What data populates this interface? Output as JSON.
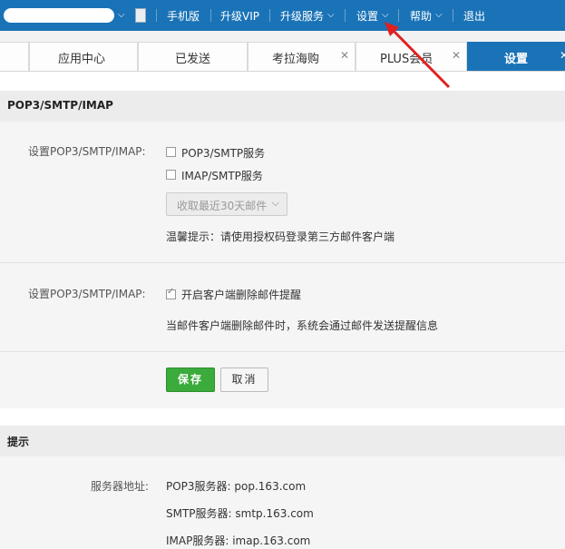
{
  "topbar": {
    "nav": [
      "手机版",
      "升级VIP",
      "升级服务",
      "设置",
      "帮助",
      "退出"
    ]
  },
  "tabs": [
    {
      "label": "应用中心",
      "closable": false,
      "active": false
    },
    {
      "label": "已发送",
      "closable": false,
      "active": false
    },
    {
      "label": "考拉海购",
      "closable": true,
      "active": false
    },
    {
      "label": "PLUS会员",
      "closable": true,
      "active": false
    },
    {
      "label": "设置",
      "closable": true,
      "active": true
    }
  ],
  "section_pop": {
    "title": "POP3/SMTP/IMAP",
    "label_1": "设置POP3/SMTP/IMAP:",
    "opt_pop3": "POP3/SMTP服务",
    "opt_imap": "IMAP/SMTP服务",
    "select_value": "收取最近30天邮件",
    "hint": "温馨提示：请使用授权码登录第三方邮件客户端",
    "label_2": "设置POP3/SMTP/IMAP:",
    "opt_delete_alert": "开启客户端删除邮件提醒",
    "delete_desc": "当邮件客户端删除邮件时，系统会通过邮件发送提醒信息",
    "opt_pop3_checked": false,
    "opt_imap_checked": false,
    "opt_delete_alert_checked": true
  },
  "buttons": {
    "save": "保存",
    "cancel": "取消"
  },
  "section_tips": {
    "title": "提示",
    "server_label": "服务器地址:",
    "pop3": "POP3服务器: pop.163.com",
    "smtp": "SMTP服务器: smtp.163.com",
    "imap": "IMAP服务器: imap.163.com"
  },
  "colors": {
    "brand_blue": "#1a73b7",
    "save_green": "#3bab3b",
    "arrow_red": "#e02020"
  },
  "icons": [
    "chevron-down-icon",
    "id-card-icon",
    "close-icon",
    "red-arrow-annotation"
  ]
}
